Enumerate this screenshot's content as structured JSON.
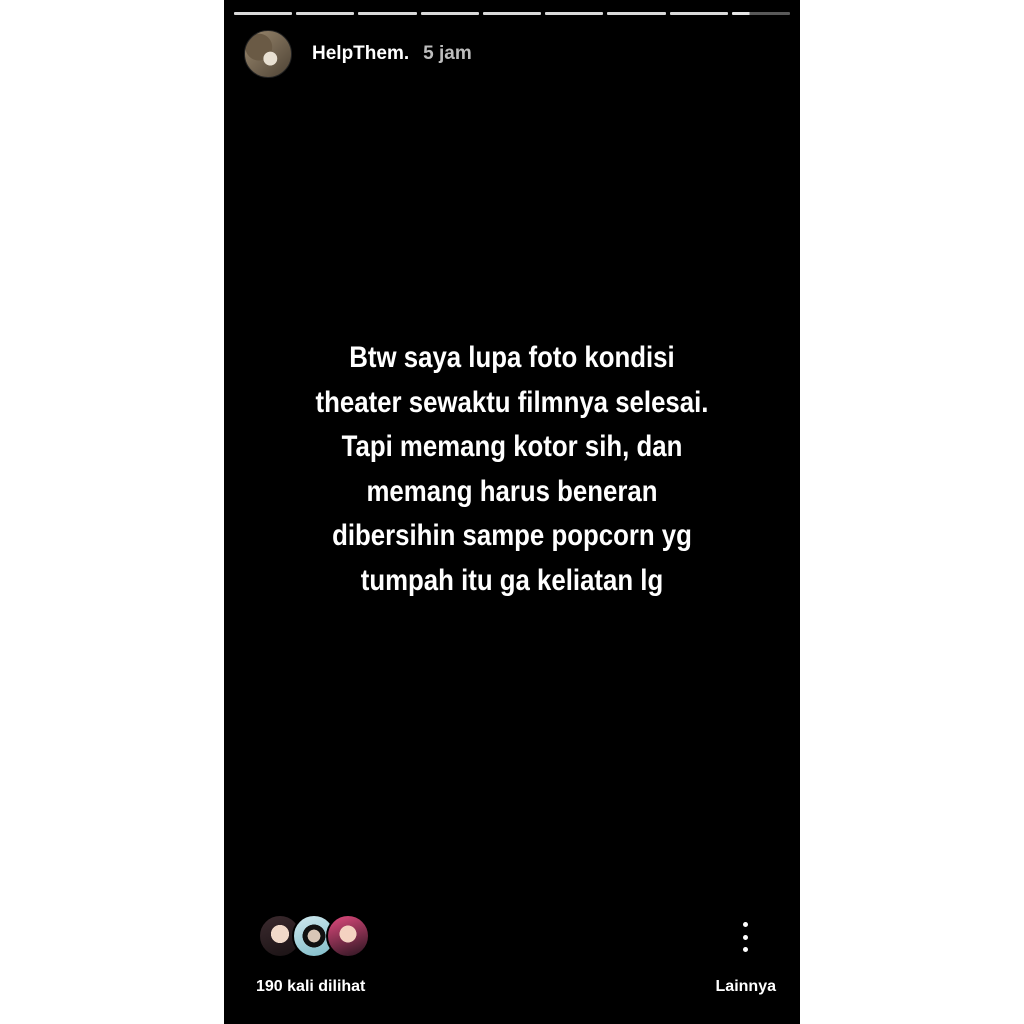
{
  "story": {
    "progress_segments": 9,
    "current_segment": 9,
    "current_segment_progress": 0.3
  },
  "header": {
    "username": "HelpThem.",
    "timestamp": "5 jam",
    "avatar_icon": "profile-avatar"
  },
  "content": {
    "lines": [
      "Btw saya lupa foto kondisi",
      "theater sewaktu filmnya selesai.",
      "Tapi memang kotor sih, dan",
      "memang harus beneran",
      "dibersihin sampe popcorn yg",
      "tumpah itu ga keliatan lg"
    ]
  },
  "footer": {
    "views_label": "190 kali dilihat",
    "more_label": "Lainnya",
    "more_icon": "vertical-dots-icon"
  },
  "colors": {
    "background": "#000000",
    "text": "#ffffff",
    "timestamp": "#bdbdbd",
    "page": "#ffffff"
  }
}
